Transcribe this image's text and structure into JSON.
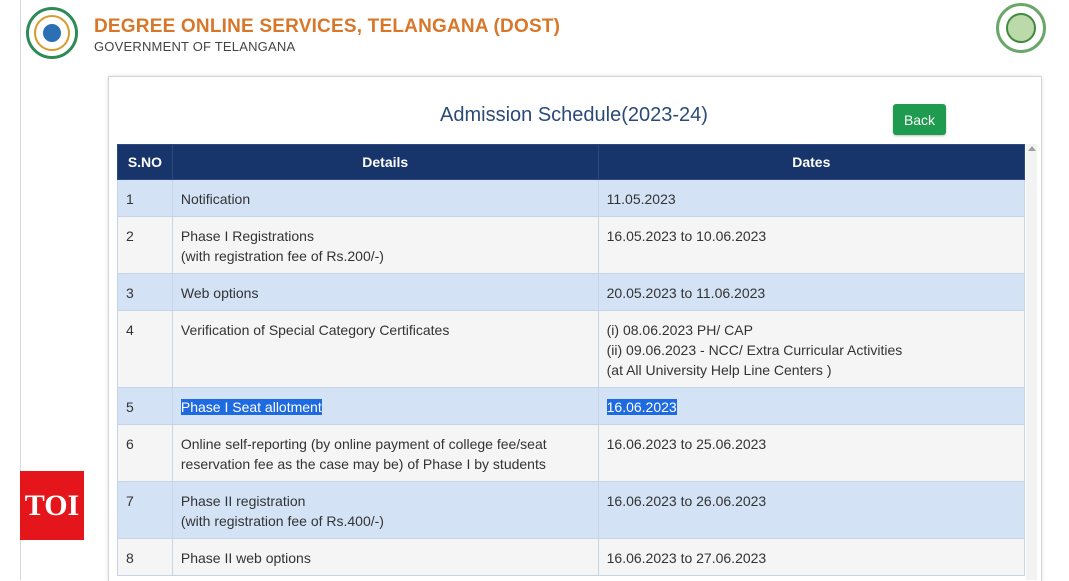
{
  "header": {
    "title": "DEGREE ONLINE SERVICES, TELANGANA (DOST)",
    "subtitle": "GOVERNMENT OF TELANGANA"
  },
  "page": {
    "title": "Admission Schedule(2023-24)",
    "back_label": "Back"
  },
  "table": {
    "columns": [
      "S.NO",
      "Details",
      "Dates"
    ],
    "rows": [
      {
        "sno": "1",
        "details": [
          "Notification"
        ],
        "dates": [
          "11.05.2023"
        ]
      },
      {
        "sno": "2",
        "details": [
          "Phase I Registrations",
          "(with registration fee of Rs.200/-)"
        ],
        "dates": [
          "16.05.2023 to 10.06.2023"
        ]
      },
      {
        "sno": "3",
        "details": [
          "Web options"
        ],
        "dates": [
          "20.05.2023 to 11.06.2023"
        ]
      },
      {
        "sno": "4",
        "details": [
          "Verification of Special Category Certificates"
        ],
        "dates": [
          "(i) 08.06.2023 PH/ CAP",
          "(ii) 09.06.2023 - NCC/ Extra Curricular Activities",
          "(at All University Help Line Centers )"
        ]
      },
      {
        "sno": "5",
        "details": [
          "Phase I Seat allotment"
        ],
        "dates": [
          "16.06.2023"
        ],
        "highlighted": true
      },
      {
        "sno": "6",
        "details": [
          "Online self-reporting (by online payment of college fee/seat",
          "reservation fee as the case may be) of Phase I by students"
        ],
        "dates": [
          "16.06.2023 to 25.06.2023"
        ]
      },
      {
        "sno": "7",
        "details": [
          "Phase II registration",
          "(with registration fee of Rs.400/-)"
        ],
        "dates": [
          "16.06.2023 to 26.06.2023"
        ]
      },
      {
        "sno": "8",
        "details": [
          "Phase II web options"
        ],
        "dates": [
          "16.06.2023 to 27.06.2023"
        ]
      }
    ]
  },
  "badge": {
    "text": "TOI"
  },
  "colors": {
    "header_title": "#d8772a",
    "table_header": "#17356b",
    "row_odd": "#d3e3f5",
    "row_even": "#f5f5f5",
    "back_button": "#1e9b4f",
    "selection": "#1e6ae0",
    "badge": "#e4161c"
  },
  "icons": {
    "left_logo": "telangana-higher-education-council-emblem",
    "right_logo": "telangana-government-emblem"
  }
}
